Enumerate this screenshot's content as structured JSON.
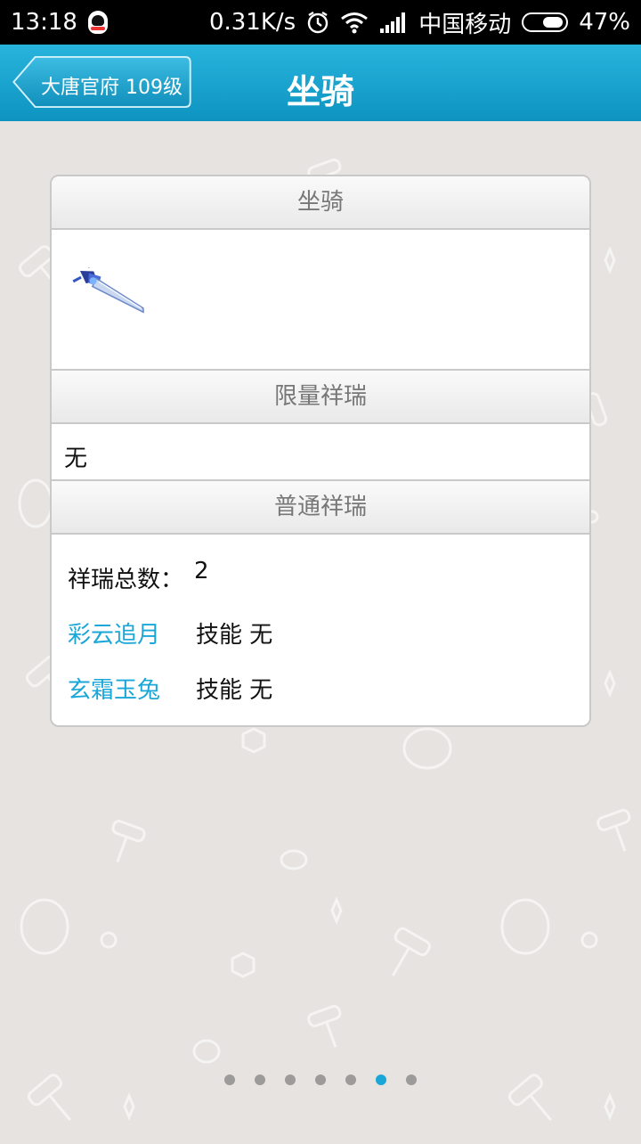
{
  "status_bar": {
    "time": "13:18",
    "speed": "0.31K/s",
    "carrier": "中国移动",
    "battery": "47%"
  },
  "nav": {
    "back_label": "大唐官府 109级",
    "title": "坐骑"
  },
  "card": {
    "mount_header": "坐骑",
    "mount_image_icon": "sword-mount-icon",
    "limited_header": "限量祥瑞",
    "limited_value": "无",
    "normal_header": "普通祥瑞",
    "total_label": "祥瑞总数：",
    "total_value": "2",
    "items": [
      {
        "name": "彩云追月",
        "skill": "技能 无"
      },
      {
        "name": "玄霜玉兔",
        "skill": "技能 无"
      }
    ]
  },
  "pager": {
    "count": 7,
    "active_index": 5
  },
  "colors": {
    "nav": "#0e93c0",
    "accent": "#1aa7d8",
    "background": "#e6e3e1"
  }
}
